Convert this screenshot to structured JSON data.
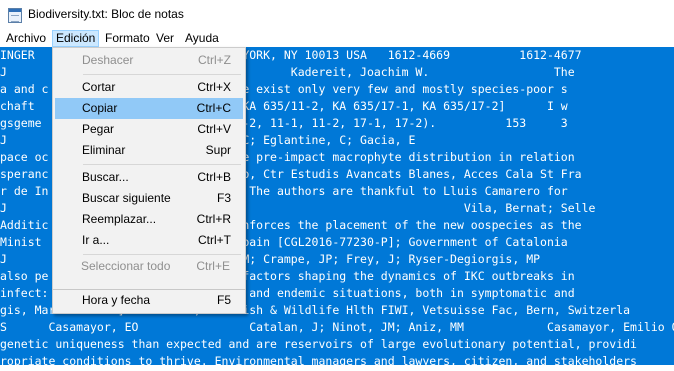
{
  "window": {
    "title": "Biodiversity.txt: Bloc de notas",
    "icon": "notepad-icon"
  },
  "menubar": {
    "items": [
      {
        "label": "Archivo"
      },
      {
        "label": "Edición"
      },
      {
        "label": "Formato"
      },
      {
        "label": "Ver"
      },
      {
        "label": "Ayuda"
      }
    ]
  },
  "edit_menu": {
    "items": [
      {
        "label": "Deshacer",
        "shortcut": "Ctrl+Z",
        "enabled": false
      },
      {
        "label": "Cortar",
        "shortcut": "Ctrl+X",
        "enabled": true
      },
      {
        "label": "Copiar",
        "shortcut": "Ctrl+C",
        "enabled": true,
        "highlighted": true
      },
      {
        "label": "Pegar",
        "shortcut": "Ctrl+V",
        "enabled": true
      },
      {
        "label": "Eliminar",
        "shortcut": "Supr",
        "enabled": true
      },
      {
        "label": "Buscar...",
        "shortcut": "Ctrl+B",
        "enabled": true
      },
      {
        "label": "Buscar siguiente",
        "shortcut": "F3",
        "enabled": true
      },
      {
        "label": "Reemplazar...",
        "shortcut": "Ctrl+R",
        "enabled": true
      },
      {
        "label": "Ir a...",
        "shortcut": "Ctrl+T",
        "enabled": true
      },
      {
        "label": "Seleccionar todo",
        "shortcut": "Ctrl+E",
        "enabled": false
      },
      {
        "label": "Hora y fecha",
        "shortcut": "F5",
        "enabled": true
      }
    ]
  },
  "document": {
    "selection_color": "#0078d7",
    "lines": [
      "INGER                    G ST, NEW YORK, NY 10013 USA   1612-4669          1612-4677",
      "J                                         Kadereit, Joachim W.                  The",
      "a and c                  area. There exist only very few and mostly species-poor s",
      "chaft                    635/11-1, KA 635/11-2, KA 635/17-1, KA 635/17-2]      I w",
      "gsgeme                   635/8-1, 8-2, 11-1, 11-2, 17-1, 17-2).          153     3",
      "J                        ; Pulido, C; Eglantine, C; Gacia, E",
      "pace oc                  ery. We use pre-impact macrophyte distribution in relation",
      "speranc                  er Ecol Grp, Ctr Estudis Avancats Blanes, Acces Cala St Fra",
      "r de In                  ref. 0065. The authors are thankful to Lluis Camarero for",
      "J                        schen, JC                                 Vila, Bernat; Selle",
      "Additic                  alysis reinforces the placement of the new oospecies as the",
      "Minist                   vidad of Spain [CGL2016-77230-P]; Government of Catalonia",
      "J                        ; Vilei, EM; Crampe, JP; Frey, J; Ryser-Degiorgis, MP",
      "also pe                  more, the factors shaping the dynamics of IKC outbreaks in",
      "infect:                  n epidemic and endemic situations, both in symptomatic and",
      "gis, Marie-Pierre] Univ Bern, Ctr Fish & Wildlife Hlth FIWI, Vetsuisse Fac, Bern, Switzerla",
      "S      Casamayor, EO                Catalan, J; Ninot, JM; Aniz, MM            Casamayor, Emilio O",
      "genetic uniqueness than expected and are reservoirs of large evolutionary potential, providi",
      "ropriate conditions to thrive. Environmental managers and lawyers, citizen, and stakeholders"
    ]
  }
}
